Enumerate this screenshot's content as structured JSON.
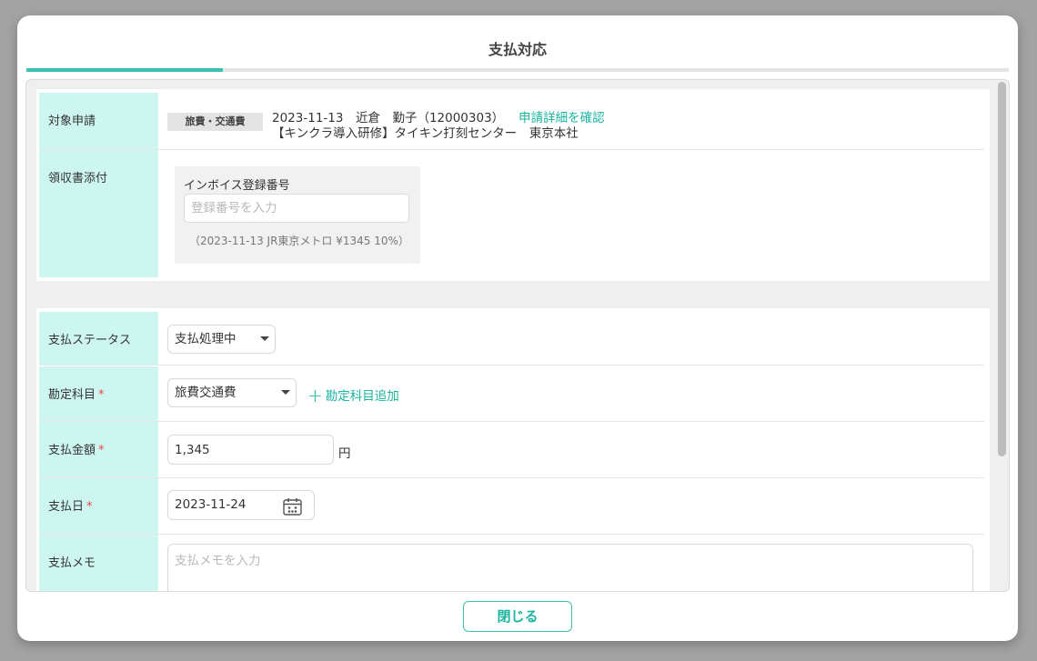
{
  "dialog": {
    "title": "支払対応",
    "close_label": "閉じる"
  },
  "application": {
    "label": "対象申請",
    "tag": "旅費・交通費",
    "summary": "2023-11-13　近倉　勤子（12000303）",
    "detail_link": "申請詳細を確認",
    "description": "【キンクラ導入研修】タイキン打刻センター　東京本社"
  },
  "receipt": {
    "label": "領収書添付",
    "invoice_label": "インボイス登録番号",
    "invoice_placeholder": "登録番号を入力",
    "invoice_value": "",
    "note": "（2023-11-13 JR東京メトロ ¥1345 10%）"
  },
  "payment": {
    "status_label": "支払ステータス",
    "status_value": "支払処理中",
    "account_label": "勘定科目",
    "account_value": "旅費交通費",
    "add_account_label": "勘定科目追加",
    "amount_label": "支払金額",
    "amount_value": "1,345",
    "amount_unit": "円",
    "date_label": "支払日",
    "date_value": "2023-11-24",
    "memo_label": "支払メモ",
    "memo_placeholder": "支払メモを入力",
    "required_mark": "*"
  },
  "colors": {
    "accent": "#3cc1b0",
    "link": "#1ab3a0",
    "label_bg": "#cdf6f1",
    "required": "#ee4444"
  }
}
